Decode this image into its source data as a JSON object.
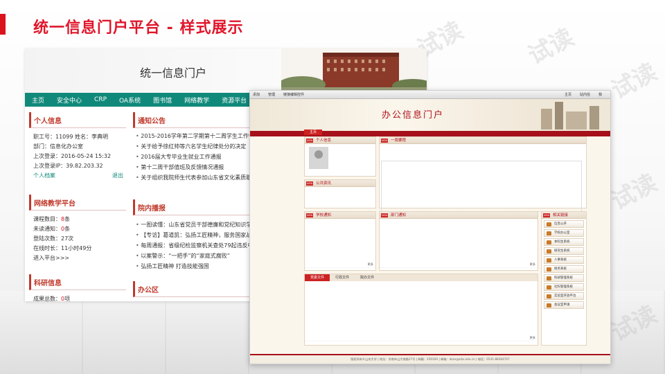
{
  "slide": {
    "title": "统一信息门户平台 - 样式展示",
    "watermark": "试读"
  },
  "portal1": {
    "title": "统一信息门户",
    "nav": [
      "主页",
      "安全中心",
      "CRP",
      "OA系统",
      "图书馆",
      "网络教学",
      "资源平台"
    ],
    "personal": {
      "heading": "个人信息",
      "line1": "职工号：11099   姓名：李典明",
      "line2": "部门：信息化办公室",
      "line3": "上次登录：2016-05-24 15:32",
      "line4": "上次登录IP：39.82.203.32",
      "archive_link": "个人档案",
      "logout_link": "退出"
    },
    "teaching": {
      "heading": "网络教学平台",
      "courses_label": "课程数目：",
      "courses_value": "8",
      "courses_unit": "条",
      "unread_label": "未读通知：",
      "unread_value": "0",
      "unread_unit": "条",
      "logins": "登陆次数：27次",
      "online": "在线时长：11小时49分",
      "enter": "进入平台>>>"
    },
    "research": {
      "heading": "科研信息",
      "results_label": "成果总数：",
      "results_value": "0",
      "results_unit": "项"
    },
    "notice": {
      "heading": "通知公告",
      "items": [
        "2015-2016学年第二学期第十二周学生工作情况通报",
        "关于给予徐红帅等六名学生纪律处分的决定",
        "2016届大专毕业生就业工作通报",
        "第十二周干部值班及反馈情况通报",
        "关于组织我院师生代表参加山东省文化素质职业教育"
      ]
    },
    "campus": {
      "heading": "院内播报",
      "items": [
        "一图读懂：山东省党员干部德廉和党纪知识学习",
        "【专访】葛道凯：弘扬工匠精神，服务国家战略",
        "每周通报：省级纪检监察机关查处79起违反中央八",
        "以案警示：“一把手”的“家庭式腐败”",
        "弘扬工匠精神 打造技能强国"
      ]
    },
    "office": {
      "heading": "办公区"
    }
  },
  "portal2": {
    "toolbar": [
      "添加",
      "管理",
      "链接编辑控件"
    ],
    "toolbar_right": [
      "主页",
      "站内信",
      "我"
    ],
    "title": "办公信息门户",
    "tab": "主页",
    "personal_heading": "个人信息",
    "public_heading": "公共资讯",
    "week_heading": "一周要程",
    "school_heading": "学校通知",
    "dept_heading": "部门通知",
    "links_heading": "相关链接",
    "sidebar": [
      "信息公开",
      "学校办公室",
      "本科生系统",
      "研究生系统",
      "人事系统",
      "财务系统",
      "科研管理系统",
      "社科管理系统",
      "实验室开放平台",
      "会议室申请"
    ],
    "doc_tabs": [
      "党委文件",
      "行政文件",
      "院办文件"
    ],
    "more": "更多",
    "footer": "版权所有©山东大学 | 地址：济南市山大南路27号 | 邮编：250100 | 邮箱：dzxx@sdu.edu.cn | 电话：0531-88364707"
  }
}
